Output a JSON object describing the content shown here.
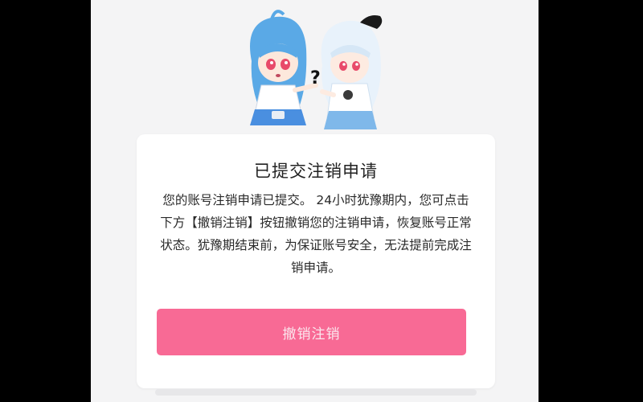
{
  "dialog": {
    "title": "已提交注销申请",
    "description": "您的账号注销申请已提交。 24小时犹豫期内，您可点击下方【撤销注销】按钮撤销您的注销申请，恢复账号正常状态。犹豫期结束前，为保证账号安全，无法提前完成注销申请。",
    "cancel_button_label": "撤销注销"
  },
  "illustration": {
    "question_mark": "?"
  },
  "colors": {
    "primary_button": "#f86a95",
    "page_background": "#f4f4f5",
    "card_background": "#ffffff"
  }
}
